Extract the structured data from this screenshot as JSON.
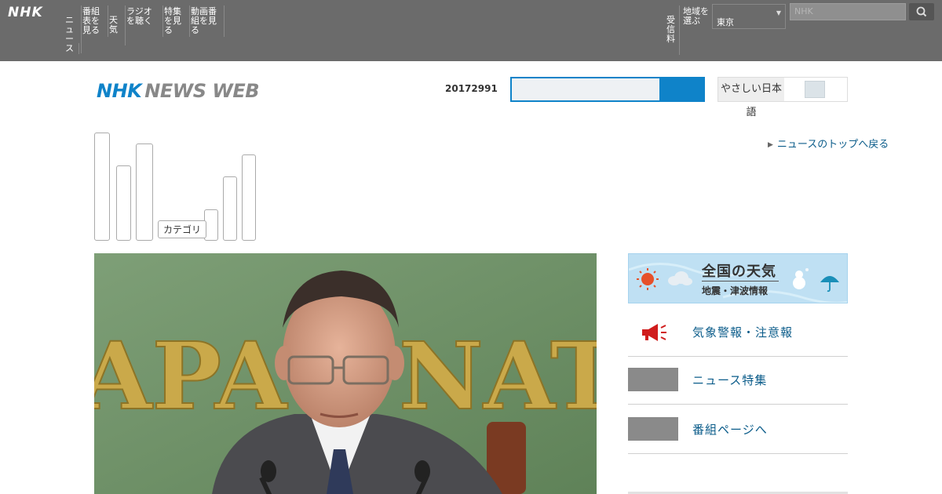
{
  "global_bar": {
    "logo": "NHK",
    "nav_items": [
      {
        "label": "ニュース"
      },
      {
        "label": "番組表を見る"
      },
      {
        "label": "天気"
      },
      {
        "label": "ラジオを聴く"
      },
      {
        "label": "特集を見る"
      },
      {
        "label": "動画番組を見る"
      }
    ],
    "right_items": [
      {
        "label": "受信料"
      },
      {
        "label": "地域を選ぶ"
      }
    ],
    "region_select": "東京",
    "search_placeholder": "NHK"
  },
  "header": {
    "logo_nhk": "NHK",
    "logo_newsweb": "NEWS WEB",
    "date_text": "20172991",
    "search_value": "",
    "lang_label": "やさしい日本語"
  },
  "categories": {
    "label": "カテゴリ"
  },
  "top_link": "ニュースのトップへ戻る",
  "weather_banner": {
    "title": "全国の天気",
    "subtitle": "地震・津波情報"
  },
  "right_links": [
    {
      "label": "気象警報・注意報",
      "icon": "megaphone-icon"
    },
    {
      "label": "ニュース特集"
    },
    {
      "label": "番組ページへ"
    }
  ],
  "colors": {
    "global_bar_bg": "#6b6b6b",
    "brand_blue": "#0f83c9",
    "link_blue": "#0b5c8a"
  }
}
